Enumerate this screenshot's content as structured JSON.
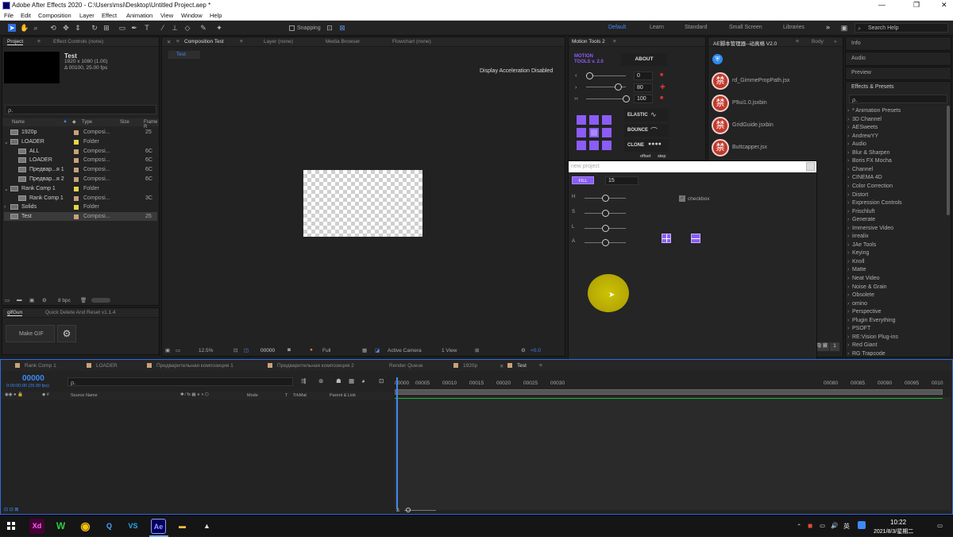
{
  "window": {
    "title": "Adobe After Effects 2020 - C:\\Users\\msi\\Desktop\\Untitled Project.aep *",
    "min": "—",
    "max": "❐",
    "close": "✕"
  },
  "menu": [
    "File",
    "Edit",
    "Composition",
    "Layer",
    "Effect",
    "Animation",
    "View",
    "Window",
    "Help"
  ],
  "toolbar": {
    "snapping": "Snapping",
    "workspaces": [
      "Default",
      "Learn",
      "Standard",
      "Small Screen",
      "Libraries"
    ],
    "active_workspace": "Default",
    "search_placeholder": "Search Help",
    "overflow": "»"
  },
  "project": {
    "tabs": [
      "Project",
      "Effect Controls (none)"
    ],
    "comp_name": "Test",
    "comp_res": "1920 x 1080 (1.00)",
    "comp_dur": "Δ 00100, 25.00 fps",
    "search": "ρ.",
    "columns": [
      "Name",
      "Type",
      "Size",
      "Frame R"
    ],
    "items": [
      {
        "name": "1920p",
        "type": "Composi...",
        "size": "",
        "fr": "25",
        "color": "#c8a27a",
        "indent": 0,
        "kind": "comp"
      },
      {
        "name": "LOADER",
        "type": "Folder",
        "size": "",
        "fr": "",
        "color": "#e5d646",
        "indent": 0,
        "kind": "folder",
        "twirl": "⌄"
      },
      {
        "name": "ALL",
        "type": "Composi...",
        "size": "",
        "fr": "6C",
        "color": "#c8a27a",
        "indent": 1,
        "kind": "comp"
      },
      {
        "name": "LOADER",
        "type": "Composi...",
        "size": "",
        "fr": "6C",
        "color": "#c8a27a",
        "indent": 1,
        "kind": "comp"
      },
      {
        "name": "Предвар...я 1",
        "type": "Composi...",
        "size": "",
        "fr": "6C",
        "color": "#c8a27a",
        "indent": 1,
        "kind": "comp"
      },
      {
        "name": "Предвар...я 2",
        "type": "Composi...",
        "size": "",
        "fr": "6C",
        "color": "#c8a27a",
        "indent": 1,
        "kind": "comp"
      },
      {
        "name": "Rank Comp 1",
        "type": "Folder",
        "size": "",
        "fr": "",
        "color": "#e5d646",
        "indent": 0,
        "kind": "folder",
        "twirl": "⌄"
      },
      {
        "name": "Rank Comp 1",
        "type": "Composi...",
        "size": "",
        "fr": "3C",
        "color": "#c8a27a",
        "indent": 1,
        "kind": "comp"
      },
      {
        "name": "Solids",
        "type": "Folder",
        "size": "",
        "fr": "",
        "color": "#e5d646",
        "indent": 0,
        "kind": "folder",
        "twirl": "›"
      },
      {
        "name": "Test",
        "type": "Composi...",
        "size": "",
        "fr": "25",
        "color": "#c8a27a",
        "indent": 0,
        "kind": "comp",
        "selected": true
      }
    ],
    "bpc": "8 bpc"
  },
  "gifgun": {
    "tabs": [
      "gifGun",
      "Quick Delete And Reset v1.1.4"
    ],
    "make_gif": "Make GIF"
  },
  "composition": {
    "tabs": [
      "Composition Test",
      "Layer (none)",
      "Media Browser",
      "Flowchart (none)"
    ],
    "subtab": "Test",
    "notice": "Display Acceleration Disabled",
    "zoom": "12.5%",
    "time": "00000",
    "quality": "Full",
    "camera": "Active Camera",
    "view": "1 View",
    "exposure": "+0.0"
  },
  "motion_tools": {
    "tab": "Motion Tools 2",
    "logo": "MOTION TOOLS v. 2.0",
    "about": "ABOUT",
    "values": [
      "0",
      "80",
      "100"
    ],
    "elastic": "ELASTIC",
    "bounce": "BOUNCE",
    "clone": "CLONE",
    "offset": "offset",
    "step": "step"
  },
  "ae_manager": {
    "tabs": [
      "AE脚本管理器--动真格 V2.0",
      "Body"
    ],
    "scripts": [
      "rd_GimmePropPath.jsx",
      "P9ui1.0.jsxbin",
      "GridGuide.jsxbin",
      "Buttcapper.jsx"
    ],
    "ban_glyph": "禁",
    "side_labels": [
      "隐 藏",
      "1"
    ]
  },
  "new_project": {
    "title": "new project",
    "fill": "FILL",
    "value": "15",
    "sliders": [
      "H",
      "S",
      "L",
      "A"
    ],
    "checkbox": "checkbox"
  },
  "right_panels": {
    "info": "Info",
    "audio": "Audio",
    "preview": "Preview",
    "effects": "Effects & Presets",
    "search": "ρ.",
    "effects_list": [
      "* Animation Presets",
      "3D Channel",
      "AESweets",
      "AndrewYY",
      "Audio",
      "Blur & Sharpen",
      "Boris FX Mocha",
      "Channel",
      "CINEMA 4D",
      "Color Correction",
      "Distort",
      "Expression Controls",
      "Frischluft",
      "Generate",
      "Immersive Video",
      "irrealix",
      "JAe Tools",
      "Keying",
      "Knoll",
      "Matte",
      "Neat Video",
      "Noise & Grain",
      "Obsolete",
      "omino",
      "Perspective",
      "Plugin Everything",
      "PSOFT",
      "RE:Vision Plug-ins",
      "Red Giant",
      "RG Trapcode"
    ]
  },
  "timeline": {
    "tabs": [
      "Rank Comp 1",
      "LOADER",
      "Предварительная композиция 1",
      "Предварительная композиция 2",
      "Render Queue",
      "1920p",
      "Test"
    ],
    "active_tab": "Test",
    "timecode": "00000",
    "sub": "0:00:00:00 (25.00 fps)",
    "search": "ρ.",
    "columns": [
      "Source Name",
      "Mode",
      "T",
      "TrkMat",
      "Parent & Link"
    ],
    "ruler": [
      "00000",
      "00005",
      "00010",
      "00015",
      "00020",
      "00025",
      "00030",
      "00080",
      "00085",
      "00090",
      "00095",
      "0010"
    ]
  },
  "taskbar": {
    "clock": "10:22",
    "date": "2021/8/3/星期二",
    "lang": "英",
    "apps": [
      "Xd",
      "W",
      "◉",
      "Q",
      "VS",
      "Ae",
      "▬",
      "▲"
    ]
  }
}
